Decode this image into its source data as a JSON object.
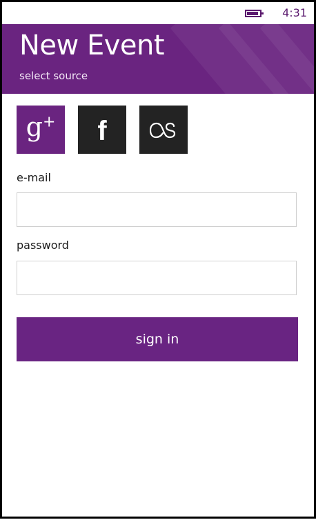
{
  "status_bar": {
    "time": "4:31",
    "battery_icon": "battery-icon"
  },
  "header": {
    "title": "New Event",
    "subtitle": "select source"
  },
  "sources": [
    {
      "name": "google-plus",
      "glyph": "g",
      "superscript": "+",
      "color": "#6a2480"
    },
    {
      "name": "facebook",
      "glyph": "f",
      "color": "#232323"
    },
    {
      "name": "lastfm",
      "glyph": "as",
      "color": "#232323"
    }
  ],
  "form": {
    "email_label": "e-mail",
    "email_value": "",
    "password_label": "password",
    "password_value": "",
    "signin_label": "sign in"
  },
  "colors": {
    "accent": "#6a2480",
    "tile_dark": "#232323"
  }
}
